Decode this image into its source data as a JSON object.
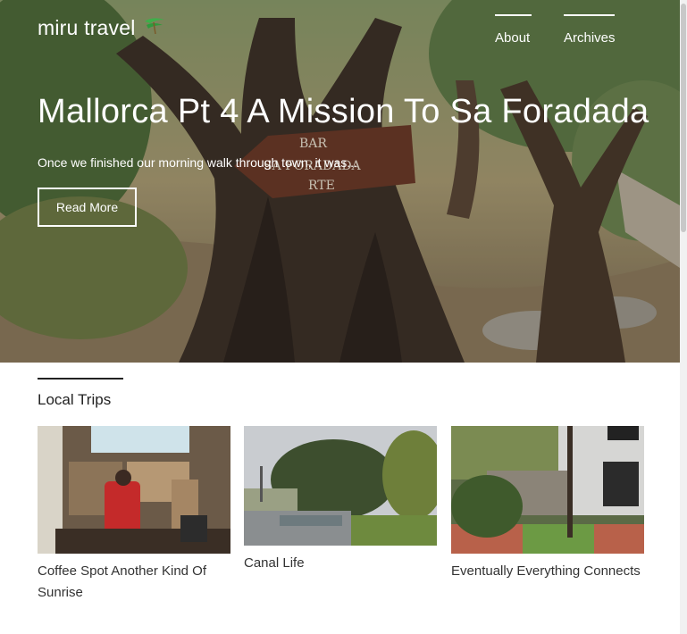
{
  "header": {
    "brand": "miru travel",
    "nav": [
      {
        "label": "About"
      },
      {
        "label": "Archives"
      }
    ]
  },
  "hero": {
    "title": "Mallorca Pt 4 A Mission To Sa Foradada",
    "excerpt": "Once we finished our morning walk through town, it was...",
    "cta_label": "Read More",
    "sign_lines": [
      "BAR",
      "SA FORADADA",
      "RTE"
    ]
  },
  "section": {
    "title": "Local Trips",
    "cards": [
      {
        "caption": "Coffee Spot Another Kind Of Sunrise"
      },
      {
        "caption": "Canal Life"
      },
      {
        "caption": "Eventually Everything Connects"
      }
    ]
  },
  "colors": {
    "accent_text": "#ffffff",
    "body_text": "#333333",
    "rule": "#222222"
  }
}
